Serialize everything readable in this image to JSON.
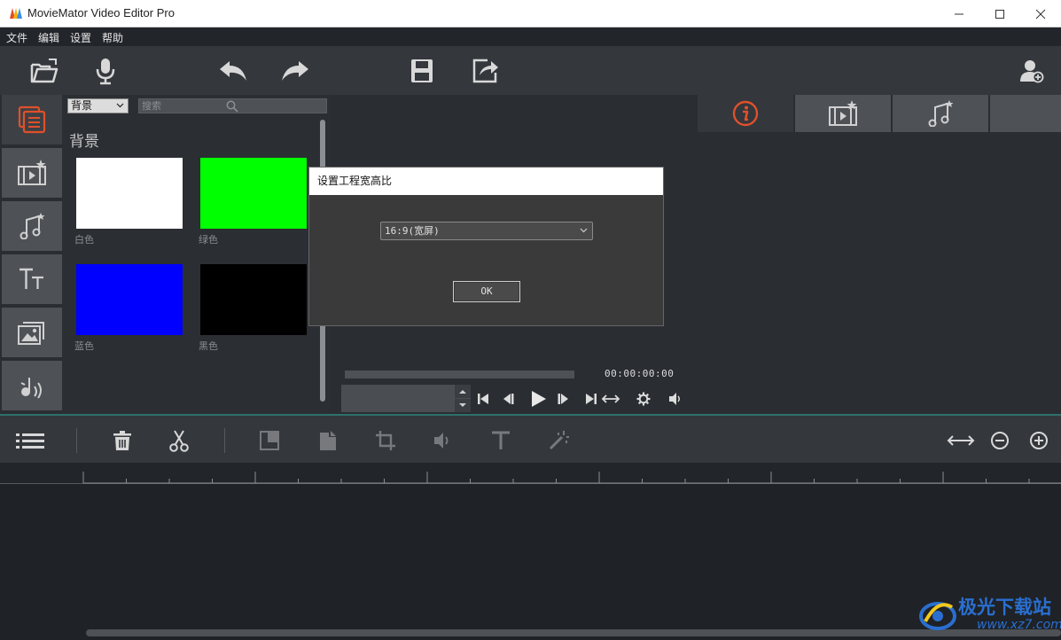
{
  "window": {
    "title": "MovieMator Video Editor Pro",
    "controls": [
      "minimize",
      "maximize",
      "close"
    ]
  },
  "menu": {
    "items": [
      "文件",
      "编辑",
      "设置",
      "帮助"
    ]
  },
  "toolbar": {
    "buttons": [
      "open-folder-icon",
      "microphone-icon",
      "undo-icon",
      "redo-icon",
      "save-icon",
      "export-icon",
      "account-icon"
    ]
  },
  "sidebar": {
    "buttons": [
      "media-library-icon",
      "video-effects-icon",
      "audio-icon",
      "text-icon",
      "image-icon",
      "audio-effect-icon"
    ],
    "active_index": 0
  },
  "browser": {
    "category_select": "背景",
    "search_placeholder": "搜索",
    "category_title": "背景",
    "swatches": [
      {
        "label": "白色",
        "color": "#ffffff"
      },
      {
        "label": "绿色",
        "color": "#00ff00"
      },
      {
        "label": "蓝色",
        "color": "#0000ff"
      },
      {
        "label": "黑色",
        "color": "#000000"
      }
    ]
  },
  "preview": {
    "timecode": "00:00:00:00"
  },
  "right_panel": {
    "tabs": [
      "info-icon",
      "video-properties-icon",
      "audio-properties-icon"
    ],
    "active_index": 0
  },
  "timeline": {
    "tools": [
      "menu-list-icon",
      "delete-icon",
      "cut-icon",
      "copy-icon",
      "paste-icon",
      "crop-icon",
      "volume-icon",
      "text-icon",
      "magic-wand-icon"
    ],
    "zoom_tools": [
      "fit-icon",
      "zoom-out-icon",
      "zoom-in-icon"
    ]
  },
  "dialog": {
    "title": "设置工程宽高比",
    "select_value": "16:9(宽屏)",
    "ok_label": "OK"
  },
  "watermark": {
    "text": "极光下载站",
    "url": "www.xz7.com"
  },
  "colors": {
    "accent": "#e0502a",
    "panel": "#2a2d32",
    "toolbar": "#34373c"
  }
}
